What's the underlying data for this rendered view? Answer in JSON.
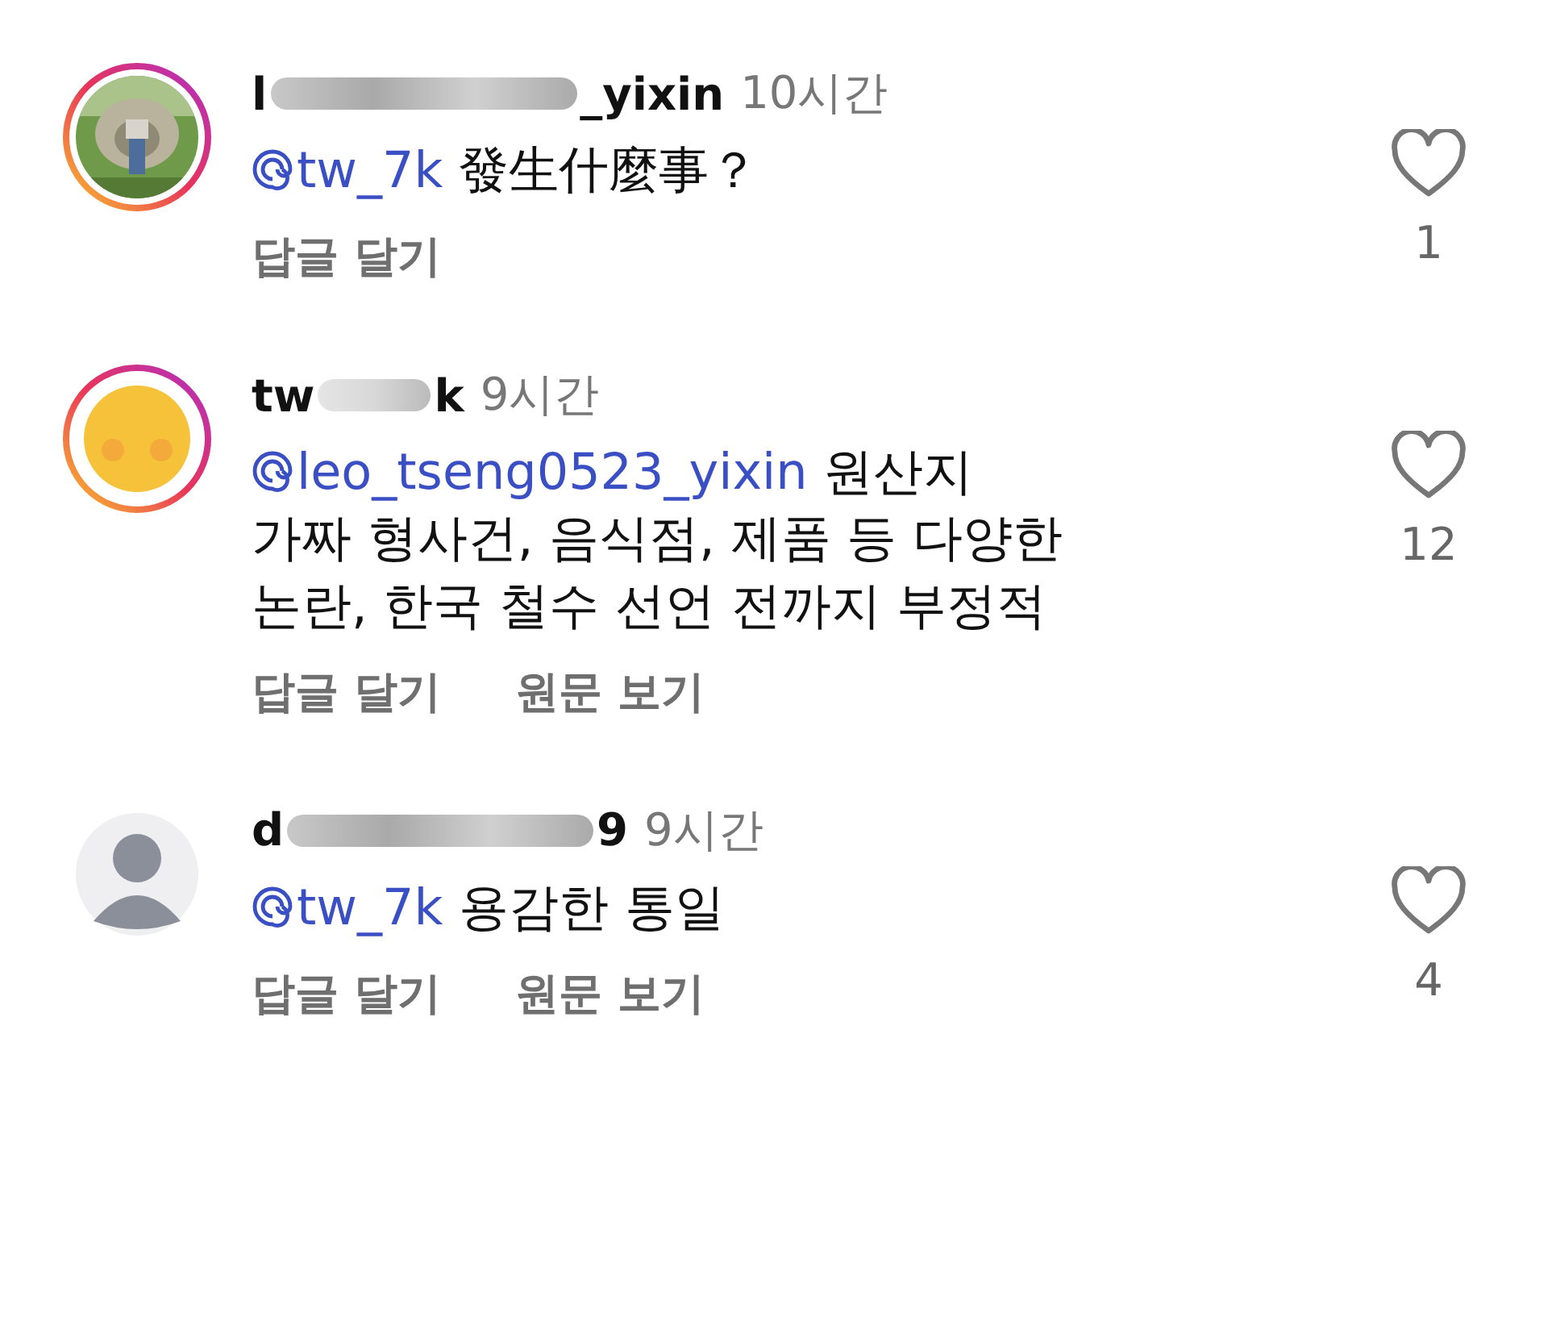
{
  "comments": [
    {
      "avatar": {
        "kind": "picture",
        "story_ring": true
      },
      "username_head": "l",
      "username_tail": "_yixin",
      "time": "10시간",
      "mention": "tw_7k",
      "text": "發生什麼事？",
      "actions": [
        "답글 달기"
      ],
      "likes": "1"
    },
    {
      "avatar": {
        "kind": "cartoon",
        "story_ring": true
      },
      "username_head": "tw",
      "username_tail": "k",
      "time": "9시간",
      "mention": "leo_tseng0523_yixin",
      "text": "원산지\n가짜 형사건, 음식점, 제품 등 다양한\n논란, 한국 철수 선언 전까지 부정적",
      "actions": [
        "답글 달기",
        "원문 보기"
      ],
      "likes": "12"
    },
    {
      "avatar": {
        "kind": "default",
        "story_ring": false
      },
      "username_head": "d",
      "username_tail": "9",
      "time": "9시간",
      "mention": "tw_7k",
      "text": "용감한 통일",
      "actions": [
        "답글 달기",
        "원문 보기"
      ],
      "likes": "4"
    }
  ]
}
